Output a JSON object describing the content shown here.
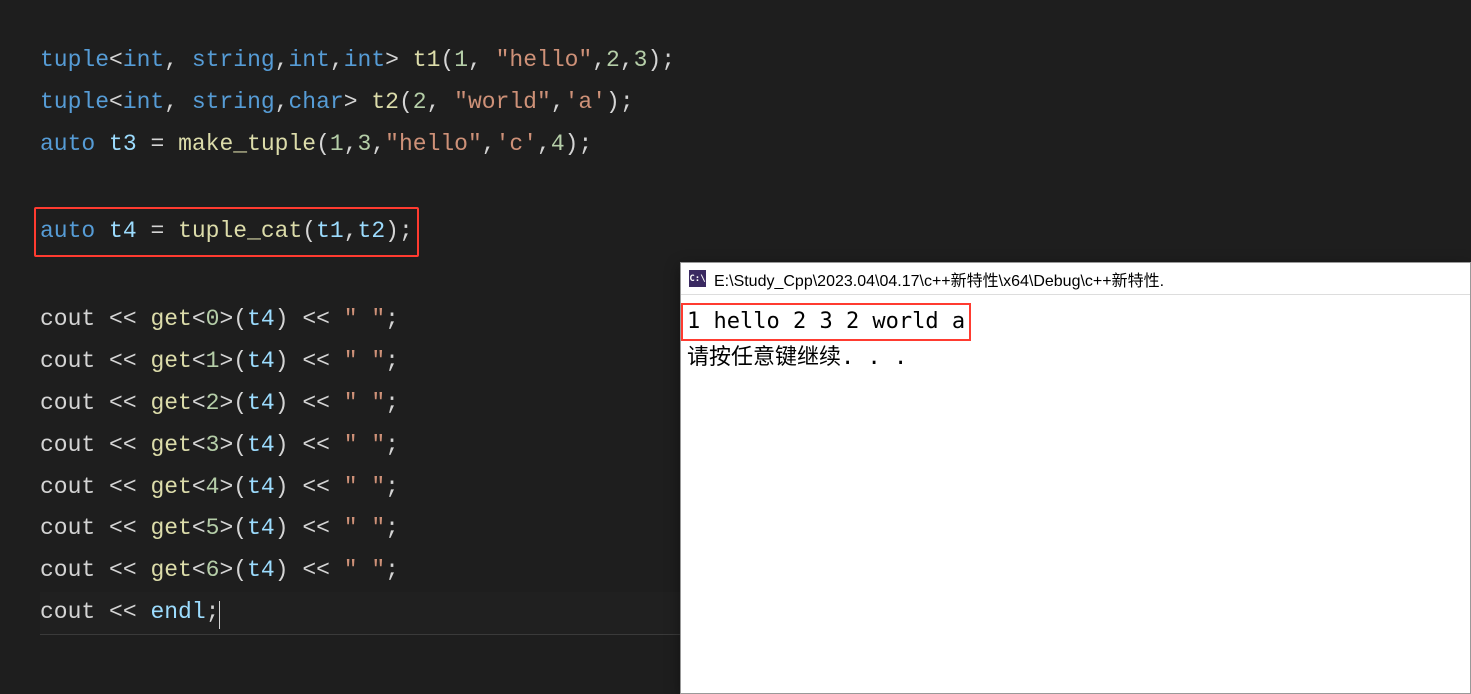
{
  "code": {
    "line1": {
      "tuple": "tuple",
      "angle_open": "<",
      "int1": "int",
      "comma1": ", ",
      "string": "string",
      "comma2": ",",
      "int2": "int",
      "comma3": ",",
      "int3": "int",
      "angle_close": "> ",
      "var": "t1",
      "paren_open": "(",
      "num1": "1",
      "comma4": ", ",
      "str": "\"hello\"",
      "comma5": ",",
      "num2": "2",
      "comma6": ",",
      "num3": "3",
      "paren_close": ")",
      "semi": ";"
    },
    "line2": {
      "tuple": "tuple",
      "angle_open": "<",
      "int1": "int",
      "comma1": ", ",
      "string": "string",
      "comma2": ",",
      "char": "char",
      "angle_close": "> ",
      "var": "t2",
      "paren_open": "(",
      "num1": "2",
      "comma3": ", ",
      "str1": "\"world\"",
      "comma4": ",",
      "str2": "'a'",
      "paren_close": ")",
      "semi": ";"
    },
    "line3": {
      "auto": "auto",
      "sp": " ",
      "var": "t3",
      "eq": " = ",
      "func": "make_tuple",
      "paren_open": "(",
      "num1": "1",
      "comma1": ",",
      "num2": "3",
      "comma2": ",",
      "str1": "\"hello\"",
      "comma3": ",",
      "str2": "'c'",
      "comma4": ",",
      "num3": "4",
      "paren_close": ")",
      "semi": ";"
    },
    "line4": {
      "auto": "auto",
      "sp": " ",
      "var": "t4",
      "eq": " = ",
      "func": "tuple_cat",
      "paren_open": "(",
      "arg1": "t1",
      "comma": ",",
      "arg2": "t2",
      "paren_close": ")",
      "semi": ";"
    },
    "print_lines": [
      {
        "cout": "cout",
        "op1": " << ",
        "get": "get",
        "ao": "<",
        "idx": "0",
        "ac": ">",
        "po": "(",
        "arg": "t4",
        "pc": ")",
        "op2": " << ",
        "str": "\" \"",
        "semi": ";"
      },
      {
        "cout": "cout",
        "op1": " << ",
        "get": "get",
        "ao": "<",
        "idx": "1",
        "ac": ">",
        "po": "(",
        "arg": "t4",
        "pc": ")",
        "op2": " << ",
        "str": "\" \"",
        "semi": ";"
      },
      {
        "cout": "cout",
        "op1": " << ",
        "get": "get",
        "ao": "<",
        "idx": "2",
        "ac": ">",
        "po": "(",
        "arg": "t4",
        "pc": ")",
        "op2": " << ",
        "str": "\" \"",
        "semi": ";"
      },
      {
        "cout": "cout",
        "op1": " << ",
        "get": "get",
        "ao": "<",
        "idx": "3",
        "ac": ">",
        "po": "(",
        "arg": "t4",
        "pc": ")",
        "op2": " << ",
        "str": "\" \"",
        "semi": ";"
      },
      {
        "cout": "cout",
        "op1": " << ",
        "get": "get",
        "ao": "<",
        "idx": "4",
        "ac": ">",
        "po": "(",
        "arg": "t4",
        "pc": ")",
        "op2": " << ",
        "str": "\" \"",
        "semi": ";"
      },
      {
        "cout": "cout",
        "op1": " << ",
        "get": "get",
        "ao": "<",
        "idx": "5",
        "ac": ">",
        "po": "(",
        "arg": "t4",
        "pc": ")",
        "op2": " << ",
        "str": "\" \"",
        "semi": ";"
      },
      {
        "cout": "cout",
        "op1": " << ",
        "get": "get",
        "ao": "<",
        "idx": "6",
        "ac": ">",
        "po": "(",
        "arg": "t4",
        "pc": ")",
        "op2": " << ",
        "str": "\" \"",
        "semi": ";"
      }
    ],
    "line_endl": {
      "cout": "cout",
      "op": " << ",
      "endl": "endl",
      "semi": ";"
    }
  },
  "console": {
    "icon_text": "C:\\",
    "title": "E:\\Study_Cpp\\2023.04\\04.17\\c++新特性\\x64\\Debug\\c++新特性.",
    "output_line1": "1 hello 2 3 2 world a",
    "output_line2": "请按任意键继续. . ."
  }
}
